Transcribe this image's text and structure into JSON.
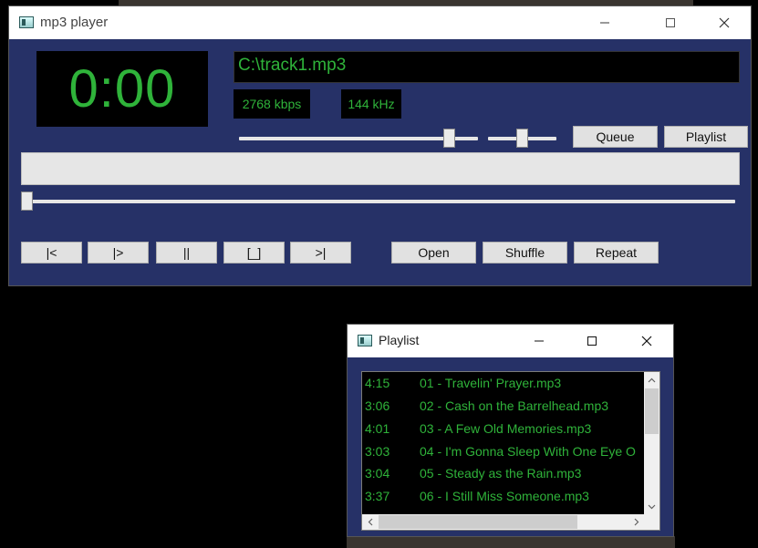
{
  "main_window": {
    "title": "mp3 player",
    "time_display": "0:00",
    "file_display": "C:\\track1.mp3",
    "bitrate": "2768 kbps",
    "samplerate": "144 kHz",
    "volume_level": 0.9,
    "balance_level": 0.5,
    "position_level": 0,
    "buttons": {
      "queue": "Queue",
      "playlist": "Playlist",
      "prev": "|<",
      "play": "|>",
      "pause": "||",
      "stop": "[_]",
      "next": ">|",
      "open": "Open",
      "shuffle": "Shuffle",
      "repeat": "Repeat"
    }
  },
  "playlist_window": {
    "title": "Playlist",
    "tracks": [
      {
        "duration": "4:15",
        "name": "01 - Travelin' Prayer.mp3"
      },
      {
        "duration": "3:06",
        "name": "02 - Cash on the Barrelhead.mp3"
      },
      {
        "duration": "4:01",
        "name": "03 - A Few Old Memories.mp3"
      },
      {
        "duration": "3:03",
        "name": "04 - I'm Gonna Sleep With One Eye O"
      },
      {
        "duration": "3:04",
        "name": "05 - Steady as the Rain.mp3"
      },
      {
        "duration": "3:37",
        "name": "06 - I Still Miss Someone.mp3"
      }
    ]
  },
  "colors": {
    "client_bg": "#263167",
    "lcd_text": "#2fb33a",
    "lcd_bg": "#000000"
  }
}
